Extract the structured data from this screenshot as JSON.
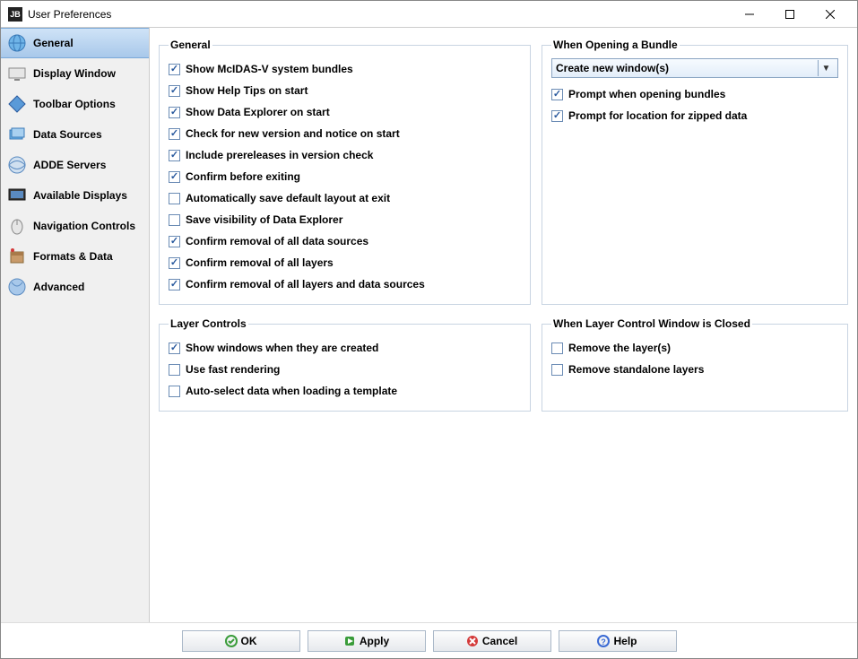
{
  "window": {
    "title": "User Preferences",
    "icon_label": "JB"
  },
  "sidebar": {
    "items": [
      {
        "label": "General",
        "icon": "globe",
        "selected": true
      },
      {
        "label": "Display Window",
        "icon": "monitor",
        "selected": false
      },
      {
        "label": "Toolbar Options",
        "icon": "diamond",
        "selected": false
      },
      {
        "label": "Data Sources",
        "icon": "layers",
        "selected": false
      },
      {
        "label": "ADDE Servers",
        "icon": "globe-net",
        "selected": false
      },
      {
        "label": "Available Displays",
        "icon": "screen",
        "selected": false
      },
      {
        "label": "Navigation Controls",
        "icon": "mouse",
        "selected": false
      },
      {
        "label": "Formats & Data",
        "icon": "archive",
        "selected": false
      },
      {
        "label": "Advanced",
        "icon": "globe-alt",
        "selected": false
      }
    ]
  },
  "panels": {
    "general": {
      "legend": "General",
      "items": [
        {
          "label": "Show McIDAS-V system bundles",
          "checked": true
        },
        {
          "label": "Show Help Tips on start",
          "checked": true
        },
        {
          "label": "Show Data Explorer on start",
          "checked": true
        },
        {
          "label": "Check for new version and notice on start",
          "checked": true
        },
        {
          "label": "Include prereleases in version check",
          "checked": true
        },
        {
          "label": "Confirm before exiting",
          "checked": true
        },
        {
          "label": "Automatically save default layout at exit",
          "checked": false
        },
        {
          "label": "Save visibility of Data Explorer",
          "checked": false
        },
        {
          "label": "Confirm removal of all data sources",
          "checked": true
        },
        {
          "label": "Confirm removal of all layers",
          "checked": true
        },
        {
          "label": "Confirm removal of all layers and data sources",
          "checked": true
        }
      ]
    },
    "bundle": {
      "legend": "When Opening a Bundle",
      "dropdown_value": "Create new window(s)",
      "items": [
        {
          "label": "Prompt when opening bundles",
          "checked": true
        },
        {
          "label": "Prompt for location for zipped data",
          "checked": true
        }
      ]
    },
    "layer_controls": {
      "legend": "Layer Controls",
      "items": [
        {
          "label": "Show windows when they are created",
          "checked": true
        },
        {
          "label": "Use fast rendering",
          "checked": false
        },
        {
          "label": "Auto-select data when loading a template",
          "checked": false
        }
      ]
    },
    "layer_closed": {
      "legend": "When Layer Control Window is Closed",
      "items": [
        {
          "label": "Remove the layer(s)",
          "checked": false
        },
        {
          "label": "Remove standalone layers",
          "checked": false
        }
      ]
    }
  },
  "buttons": {
    "ok": "OK",
    "apply": "Apply",
    "cancel": "Cancel",
    "help": "Help"
  }
}
